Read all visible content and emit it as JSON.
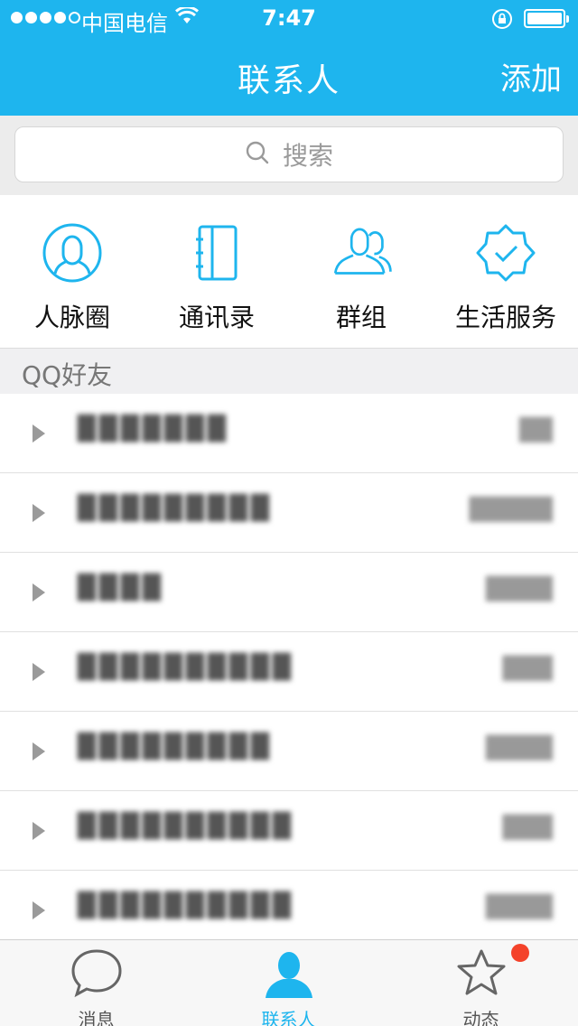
{
  "status_bar": {
    "carrier": "中国电信",
    "time": "7:47"
  },
  "nav": {
    "title": "联系人",
    "add_label": "添加"
  },
  "search": {
    "placeholder": "搜索"
  },
  "quick_entries": [
    {
      "label": "人脉圈",
      "icon": "people-circle-icon"
    },
    {
      "label": "通讯录",
      "icon": "address-book-icon"
    },
    {
      "label": "群组",
      "icon": "group-icon"
    },
    {
      "label": "生活服务",
      "icon": "badge-check-icon"
    }
  ],
  "section": {
    "label": "QQ好友"
  },
  "groups": [
    {
      "name": "███████",
      "count": "██"
    },
    {
      "name": "█████████",
      "count": "█████"
    },
    {
      "name": "████",
      "count": "████"
    },
    {
      "name": "██████████",
      "count": "███"
    },
    {
      "name": "█████████",
      "count": "████"
    },
    {
      "name": "██████████",
      "count": "███"
    },
    {
      "name": "██████████",
      "count": "████"
    }
  ],
  "tabbar": {
    "tabs": [
      {
        "label": "消息",
        "icon": "message-bubble-icon",
        "active": false
      },
      {
        "label": "联系人",
        "icon": "person-icon",
        "active": true
      },
      {
        "label": "动态",
        "icon": "star-icon",
        "active": false
      }
    ]
  },
  "colors": {
    "accent": "#1eb5ee",
    "badge": "#f4422a"
  }
}
